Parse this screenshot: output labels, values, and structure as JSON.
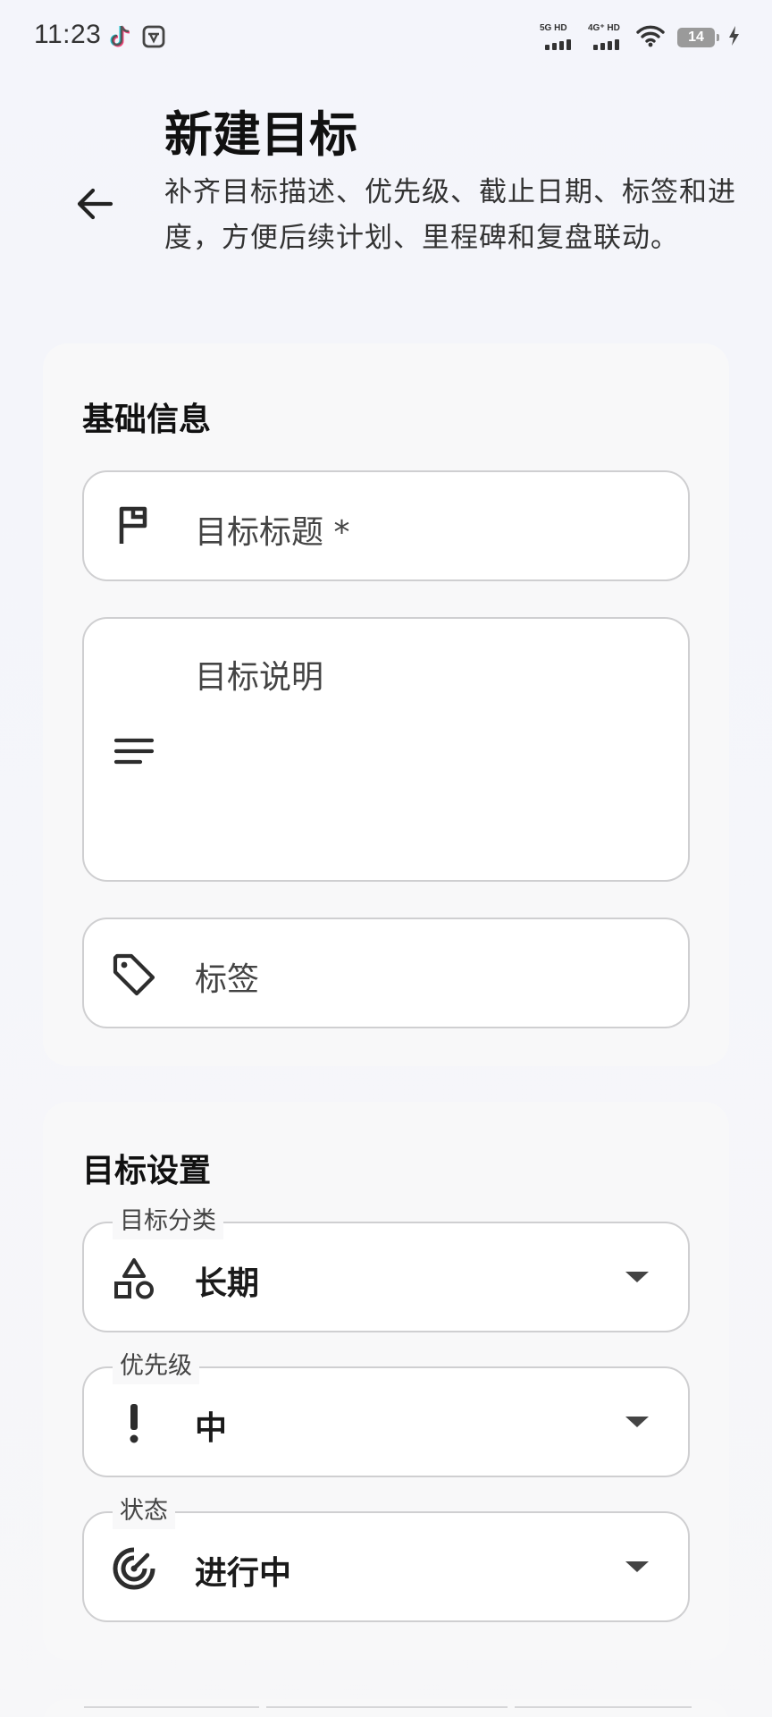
{
  "status_bar": {
    "time": "11:23",
    "signal_1_label": "5G HD",
    "signal_2_label": "4G⁺ HD",
    "battery": "14"
  },
  "header": {
    "title": "新建目标",
    "description": "补齐目标描述、优先级、截止日期、标签和进度，方便后续计划、里程碑和复盘联动。"
  },
  "basic_info": {
    "section_title": "基础信息",
    "title_field": {
      "placeholder": "目标标题 *",
      "icon": "flag-icon"
    },
    "description_field": {
      "placeholder": "目标说明",
      "icon": "notes-icon"
    },
    "tags_field": {
      "placeholder": "标签",
      "icon": "tag-icon"
    }
  },
  "goal_settings": {
    "section_title": "目标设置",
    "category": {
      "label": "目标分类",
      "value": "长期",
      "icon": "shapes-icon"
    },
    "priority": {
      "label": "优先级",
      "value": "中",
      "icon": "exclamation-icon"
    },
    "status": {
      "label": "状态",
      "value": "进行中",
      "icon": "target-icon"
    }
  },
  "colors": {
    "background": "#f4f5fa",
    "card": "#f8f8f9",
    "field_border": "#cfcfd1",
    "text_primary": "#111111"
  }
}
